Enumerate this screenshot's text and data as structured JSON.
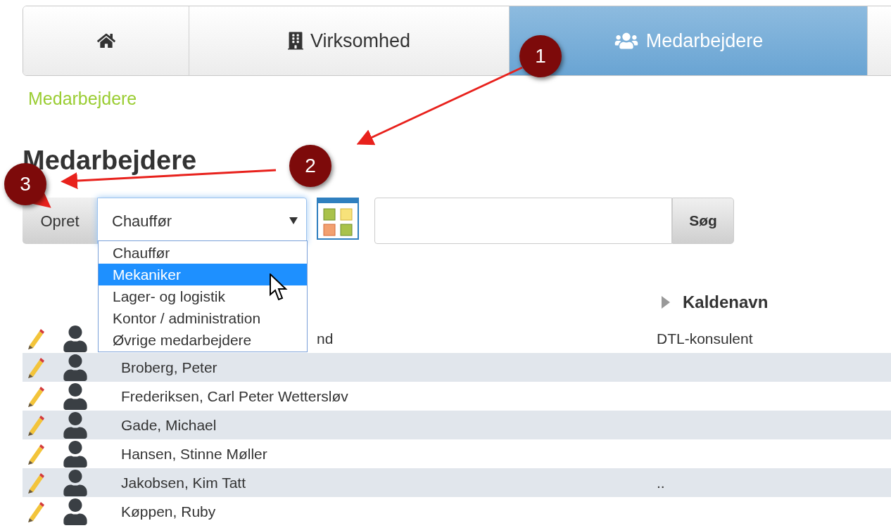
{
  "nav_tabs": [
    {
      "kind": "home",
      "selected": false
    },
    {
      "kind": "building",
      "label": "Virksomhed",
      "selected": false
    },
    {
      "kind": "users",
      "label": "Medarbejdere",
      "selected": true
    },
    {
      "kind": "blank",
      "selected": false
    }
  ],
  "breadcrumb": "Medarbejdere",
  "heading": "Medarbejdere",
  "toolbar": {
    "create_button": "Opret",
    "category_select": {
      "value": "Chauffør",
      "expanded": true,
      "options": [
        {
          "label": "Chauffør",
          "highlighted": false
        },
        {
          "label": "Mekaniker",
          "highlighted": true
        },
        {
          "label": "Lager- og logistik",
          "highlighted": false
        },
        {
          "label": "Kontor / administration",
          "highlighted": false
        },
        {
          "label": "Øvrige medarbejdere",
          "highlighted": false
        }
      ]
    },
    "search_button": "Søg"
  },
  "table": {
    "header": "Kaldenavn",
    "rows": [
      {
        "name": "nd",
        "nickname": "DTL-konsulent",
        "covered": true
      },
      {
        "name": "Broberg, Peter",
        "covered": false
      },
      {
        "name": "Frederiksen, Carl Peter Wettersløv",
        "covered": false
      },
      {
        "name": "Gade, Michael",
        "covered": false
      },
      {
        "name": "Hansen, Stinne Møller",
        "covered": false
      },
      {
        "name": "Jakobsen, Kim Tatt",
        "nickname": "..",
        "covered": false
      },
      {
        "name": "Køppen, Ruby",
        "covered": false
      }
    ]
  },
  "annotations": [
    {
      "label": "1"
    },
    {
      "label": "2"
    },
    {
      "label": "3"
    }
  ]
}
